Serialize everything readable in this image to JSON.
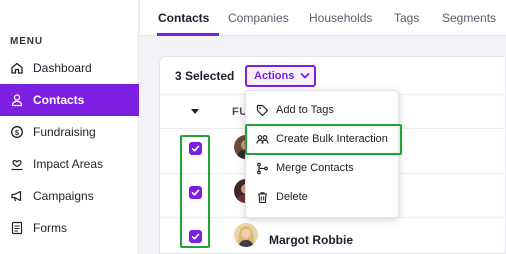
{
  "sidebar": {
    "heading": "MENU",
    "items": [
      {
        "label": "Dashboard",
        "icon": "home-icon"
      },
      {
        "label": "Contacts",
        "icon": "person-icon",
        "active": true
      },
      {
        "label": "Fundraising",
        "icon": "dollar-coin-icon"
      },
      {
        "label": "Impact Areas",
        "icon": "hand-heart-icon"
      },
      {
        "label": "Campaigns",
        "icon": "megaphone-icon"
      },
      {
        "label": "Forms",
        "icon": "form-icon"
      }
    ]
  },
  "tabs": [
    {
      "label": "Contacts",
      "active": true
    },
    {
      "label": "Companies"
    },
    {
      "label": "Households"
    },
    {
      "label": "Tags"
    },
    {
      "label": "Segments"
    }
  ],
  "toolbar": {
    "selected_label": "3 Selected",
    "actions_label": "Actions"
  },
  "table": {
    "column_header": "FU",
    "rows": [
      {
        "name": "",
        "checked": true
      },
      {
        "name": "",
        "checked": true
      },
      {
        "name": "Margot Robbie",
        "checked": true
      }
    ]
  },
  "dropdown": {
    "items": [
      {
        "label": "Add to Tags",
        "icon": "tag-icon"
      },
      {
        "label": "Create Bulk Interaction",
        "icon": "people-icon",
        "highlighted": true
      },
      {
        "label": "Merge Contacts",
        "icon": "merge-icon"
      },
      {
        "label": "Delete",
        "icon": "trash-icon"
      }
    ]
  },
  "colors": {
    "accent": "#7c1fe0",
    "highlight": "#22a33a",
    "background": "#f3f2f6"
  }
}
